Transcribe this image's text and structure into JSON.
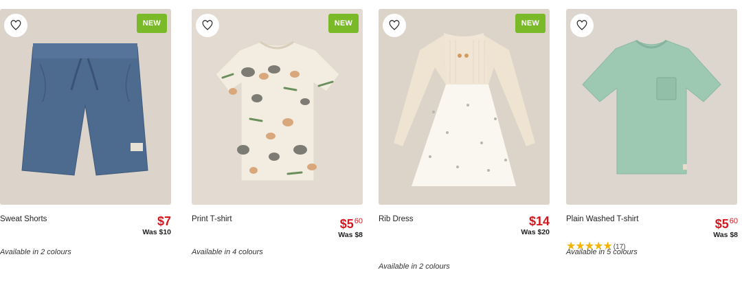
{
  "products": [
    {
      "name": "Print T-shirt",
      "badge": "NEW",
      "price_dollars": "$5",
      "price_cents": "60",
      "was": "Was $8",
      "colours": "Available in 4 colours",
      "image_bg": "#e3dbd1",
      "garment_color": "#f3ece0"
    },
    {
      "name": "Rib Dress",
      "badge": "NEW",
      "price_dollars": "$14",
      "price_cents": "",
      "was": "Was $20",
      "colours": "Available in 2 colours",
      "image_bg": "#ddd4c9",
      "garment_color": "#f4ebdd"
    },
    {
      "name": "Plain Washed T-shirt",
      "badge": "",
      "price_dollars": "$5",
      "price_cents": "60",
      "was": "Was $8",
      "rating_stars": 5,
      "rating_count": "(17)",
      "colours": "Available in 5 colours",
      "image_bg": "#ddd6ce",
      "garment_color": "#9dc8b2"
    },
    {
      "name": "Sweat Shorts",
      "badge": "NEW",
      "price_dollars": "$7",
      "price_cents": "",
      "was": "Was $10",
      "colours": "Available in 2 colours",
      "image_bg": "#dcd4ca",
      "garment_color": "#4d6a8f"
    }
  ],
  "colors": {
    "badge": "#7ab928",
    "price": "#d3191f",
    "star": "#f2b400"
  },
  "icons": {
    "favourite": "heart-outline-icon",
    "rating": "star-icon"
  }
}
